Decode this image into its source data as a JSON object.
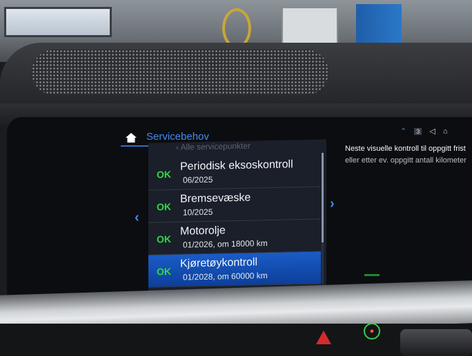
{
  "header": {
    "title": "Servicebehov",
    "status_badge": "3"
  },
  "list": {
    "faded_top": "‹  Alle servicepunkter",
    "items": [
      {
        "status": "OK",
        "name": "Periodisk eksoskontroll",
        "date": "06/2025"
      },
      {
        "status": "OK",
        "name": "Bremsevæske",
        "date": "10/2025"
      },
      {
        "status": "OK",
        "name": "Motorolje",
        "date": "01/2026, om 18000 km"
      },
      {
        "status": "OK",
        "name": "Kjøretøykontroll",
        "date": "01/2028, om 60000 km"
      }
    ],
    "selected_index": 3
  },
  "details": {
    "line1": "Neste visuelle kontroll til oppgitt frist",
    "line2": "eller etter ev. oppgitt antall kilometer"
  },
  "icons": {
    "home": "home-icon",
    "prev": "chevron-left-icon",
    "next": "chevron-right-icon",
    "up": "chevron-up-icon",
    "volume": "speaker-icon",
    "user": "user-icon"
  },
  "colors": {
    "accent": "#3f8cf2",
    "ok": "#2fdc3e",
    "selected_row": "#1a5cc8"
  }
}
